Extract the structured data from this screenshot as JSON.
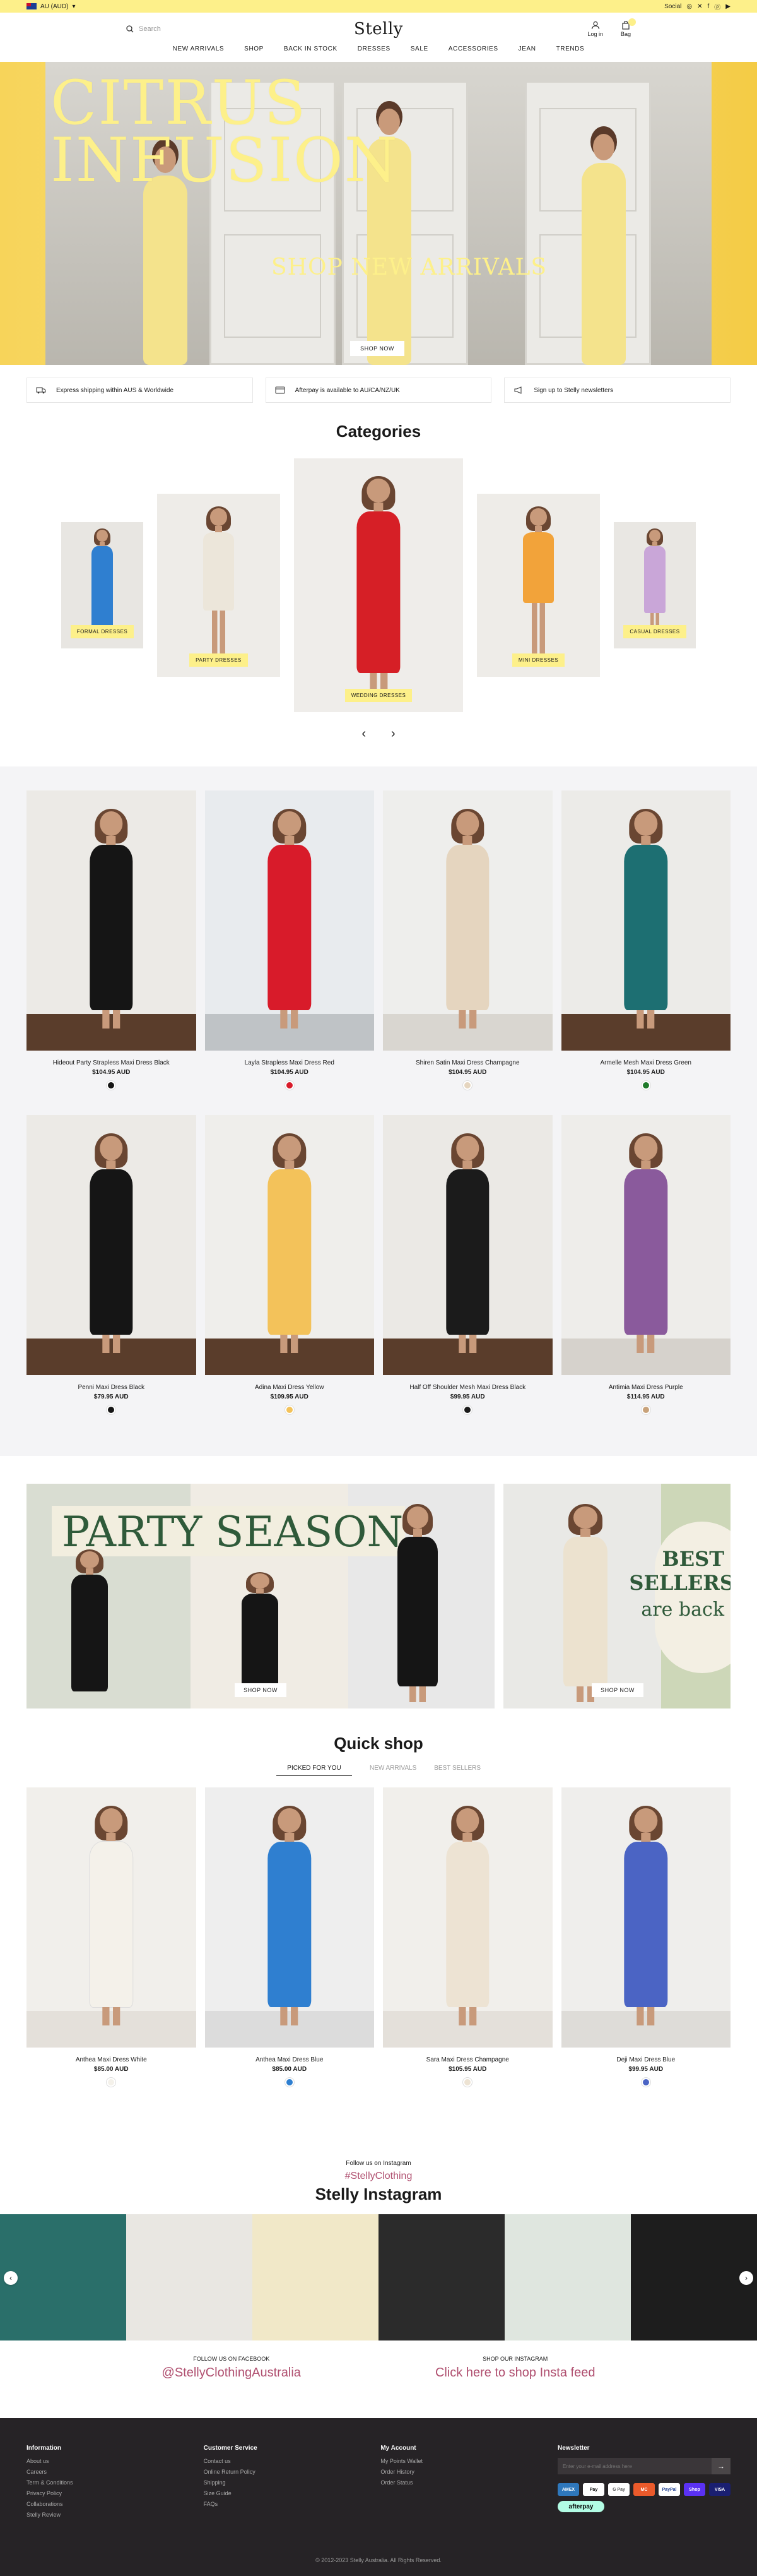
{
  "topbar": {
    "currency": "AU (AUD)",
    "social_label": "Social"
  },
  "header": {
    "search_placeholder": "Search",
    "logo": "Stelly",
    "login_label": "Log in",
    "bag_label": "Bag"
  },
  "nav": [
    "NEW ARRIVALS",
    "SHOP",
    "BACK IN STOCK",
    "DRESSES",
    "SALE",
    "ACCESSORIES",
    "JEAN",
    "TRENDS"
  ],
  "hero": {
    "title": "CITRUS\nINFUSION",
    "subtitle": "SHOP NEW ARRIVALS",
    "button": "SHOP NOW"
  },
  "usp": [
    {
      "icon": "truck-icon",
      "text": "Express shipping within AUS & Worldwide"
    },
    {
      "icon": "card-icon",
      "text": "Afterpay is available to AU/CA/NZ/UK"
    },
    {
      "icon": "megaphone-icon",
      "text": "Sign up to Stelly newsletters"
    }
  ],
  "categories": {
    "title": "Categories",
    "items": [
      {
        "label": "FORMAL DRESSES",
        "color": "#2f7fd0"
      },
      {
        "label": "PARTY DRESSES",
        "color": "#ece6da"
      },
      {
        "label": "WEDDING DRESSES",
        "color": "#d61f26"
      },
      {
        "label": "MINI DRESSES",
        "color": "#f2a33a"
      },
      {
        "label": "CASUAL DRESSES",
        "color": "#c9a6d8"
      }
    ]
  },
  "products": [
    {
      "name": "Hideout Party Strapless Maxi Dress Black",
      "price": "$104.95 AUD",
      "color": "#151515"
    },
    {
      "name": "Layla Strapless Maxi Dress Red",
      "price": "$104.95 AUD",
      "color": "#d81b2a"
    },
    {
      "name": "Shiren Satin Maxi Dress Champagne",
      "price": "$104.95 AUD",
      "color": "#e5d5bf"
    },
    {
      "name": "Armelle Mesh Maxi Dress Green",
      "price": "$104.95 AUD",
      "color": "#1d6f72"
    },
    {
      "name": "Penni Maxi Dress Black",
      "price": "$79.95 AUD",
      "color": "#151515"
    },
    {
      "name": "Adina Maxi Dress Yellow",
      "price": "$109.95 AUD",
      "color": "#f3c25a"
    },
    {
      "name": "Half Off Shoulder Mesh Maxi Dress Black",
      "price": "$99.95 AUD",
      "color": "#1b1b1b"
    },
    {
      "name": "Antimia Maxi Dress Purple",
      "price": "$114.95 AUD",
      "color": "#8a5a9c"
    }
  ],
  "promo": {
    "left_text": "PARTY SEASON",
    "left_button": "SHOP NOW",
    "right_text_1": "BEST",
    "right_text_2": "SELLERS",
    "right_text_3": "are back",
    "right_button": "SHOP NOW"
  },
  "quickshop": {
    "title": "Quick shop",
    "tabs": [
      "PICKED FOR YOU",
      "NEW ARRIVALS",
      "BEST SELLERS"
    ],
    "items": [
      {
        "name": "Anthea Maxi Dress White",
        "price": "$85.00 AUD",
        "color": "#f4f1ea"
      },
      {
        "name": "Anthea Maxi Dress Blue",
        "price": "$85.00 AUD",
        "color": "#2f7fd0"
      },
      {
        "name": "Sara Maxi Dress Champagne",
        "price": "$105.95 AUD",
        "color": "#ede3d3"
      },
      {
        "name": "Deji Maxi Dress Blue",
        "price": "$99.95 AUD",
        "color": "#4b64c4"
      }
    ]
  },
  "instagram": {
    "small": "Follow us on Instagram",
    "tag": "#StellyClothing",
    "title": "Stelly Instagram",
    "facebook_small": "Follow us on Facebook",
    "facebook_link": "@StellyClothingAustralia",
    "shop_small": "SHOP OUR INSTAGRAM",
    "shop_link": "Click here to shop Insta feed"
  },
  "footer": {
    "col1": {
      "title": "Information",
      "items": [
        "About us",
        "Careers",
        "Term & Conditions",
        "Privacy Policy",
        "Collaborations",
        "Stelly Review"
      ]
    },
    "col2": {
      "title": "Customer Service",
      "items": [
        "Contact us",
        "Online Return Policy",
        "Shipping",
        "Size Guide",
        "FAQs"
      ]
    },
    "col3": {
      "title": "My Account",
      "items": [
        "My Points Wallet",
        "Order History",
        "Order Status"
      ]
    },
    "newsletter": {
      "title": "Newsletter",
      "placeholder": "Enter your e-mail address here"
    },
    "payments": [
      "AMEX",
      "Pay",
      "G Pay",
      "MC",
      "PayPal",
      "Shop",
      "VISA"
    ],
    "afterpay": "afterpay",
    "copyright": "© 2012-2023 Stelly Australia. All Rights Reserved."
  }
}
